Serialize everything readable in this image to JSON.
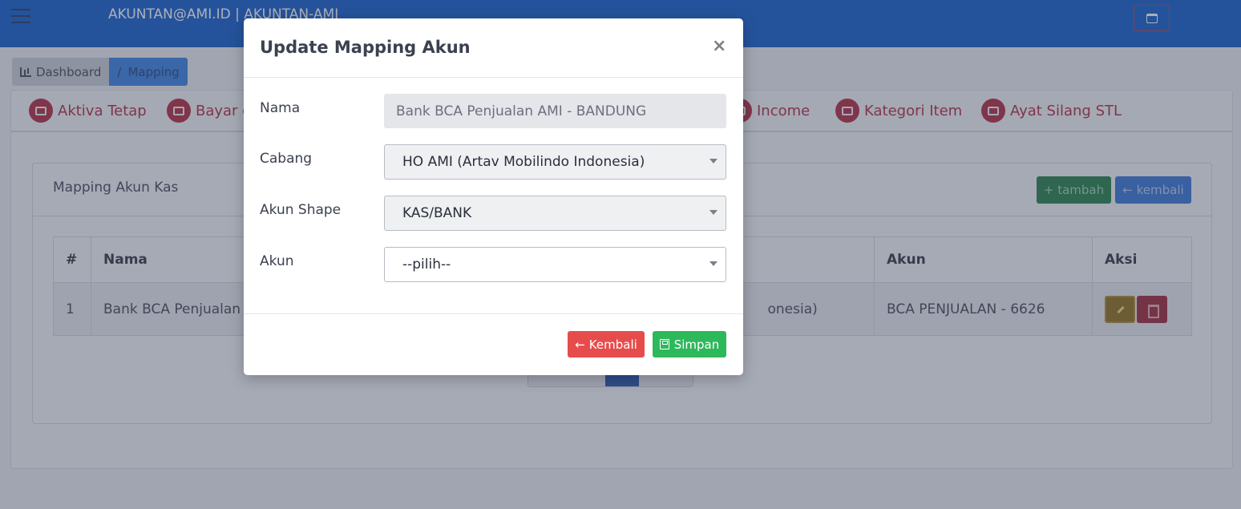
{
  "topbar": {
    "title": "AKUNTAN@AMI.ID | AKUNTAN-AMI"
  },
  "breadcrumb": {
    "items": [
      {
        "label": "Dashboard"
      },
      {
        "label": "Mapping",
        "separator": "/"
      }
    ]
  },
  "tabs": [
    {
      "label": "Aktiva Tetap",
      "icon": "factory-icon"
    },
    {
      "label": "Bayar di",
      "icon": "wallet-icon"
    },
    {
      "label": "Income",
      "icon": "wallet-icon"
    },
    {
      "label": "Kategori Item",
      "icon": "checkbox-icon"
    },
    {
      "label": "Ayat Silang STL",
      "icon": "wallet-icon"
    }
  ],
  "card": {
    "title": "Mapping Akun Kas",
    "add_label": "+ tambah",
    "back_label": "← kembali"
  },
  "table": {
    "headers": [
      "#",
      "Nama",
      "Akun",
      "Aksi"
    ],
    "rows": [
      {
        "no": "1",
        "nama": "Bank BCA Penjualan AM",
        "cabang_partial": "onesia)",
        "akun": "BCA PENJUALAN - 6626"
      }
    ]
  },
  "modal": {
    "title": "Update Mapping Akun",
    "close": "×",
    "fields": {
      "nama_label": "Nama",
      "nama_value": "Bank BCA Penjualan AMI - BANDUNG",
      "cabang_label": "Cabang",
      "cabang_value": "HO AMI (Artav Mobilindo Indonesia)",
      "akun_shape_label": "Akun Shape",
      "akun_shape_value": "KAS/BANK",
      "akun_label": "Akun",
      "akun_value": "--pilih--"
    },
    "buttons": {
      "kembali": "Kembali",
      "simpan": "Simpan"
    }
  },
  "colors": {
    "topbar": "#0a58c8",
    "tab_accent": "#b02238",
    "btn_kembali": "#e74c4c",
    "btn_simpan": "#2eb85c"
  }
}
